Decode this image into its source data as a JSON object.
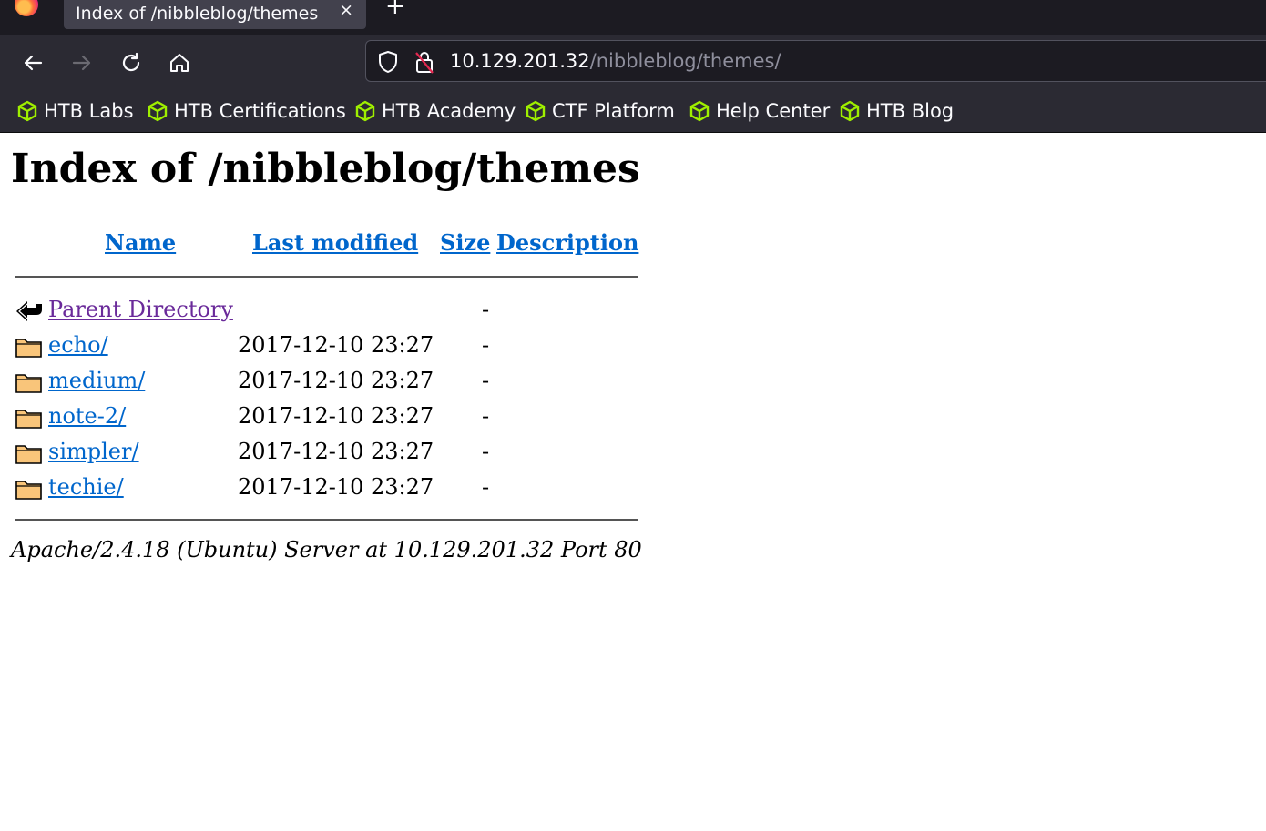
{
  "browser": {
    "tab_title": "Index of /nibbleblog/themes",
    "tab_close": "×",
    "new_tab": "+",
    "url_host": "10.129.201.32",
    "url_path": "/nibbleblog/themes/"
  },
  "bookmarks": [
    {
      "label": "HTB Labs"
    },
    {
      "label": "HTB Certifications"
    },
    {
      "label": "HTB Academy"
    },
    {
      "label": "CTF Platform"
    },
    {
      "label": "Help Center"
    },
    {
      "label": "HTB Blog"
    }
  ],
  "page": {
    "heading": "Index of /nibbleblog/themes",
    "columns": {
      "name": "Name",
      "modified": "Last modified",
      "size": "Size",
      "description": "Description"
    },
    "entries": [
      {
        "name": "Parent Directory",
        "modified": "",
        "size": "-",
        "icon": "back-arrow-icon"
      },
      {
        "name": "echo/",
        "modified": "2017-12-10 23:27",
        "size": "-",
        "icon": "folder-icon"
      },
      {
        "name": "medium/",
        "modified": "2017-12-10 23:27",
        "size": "-",
        "icon": "folder-icon"
      },
      {
        "name": "note-2/",
        "modified": "2017-12-10 23:27",
        "size": "-",
        "icon": "folder-icon"
      },
      {
        "name": "simpler/",
        "modified": "2017-12-10 23:27",
        "size": "-",
        "icon": "folder-icon"
      },
      {
        "name": "techie/",
        "modified": "2017-12-10 23:27",
        "size": "-",
        "icon": "folder-icon"
      }
    ],
    "footer": "Apache/2.4.18 (Ubuntu) Server at 10.129.201.32 Port 80"
  },
  "colors": {
    "link": "#0066cc",
    "visited": "#6a2a9a",
    "bookmark_icon": "#9fef00"
  }
}
